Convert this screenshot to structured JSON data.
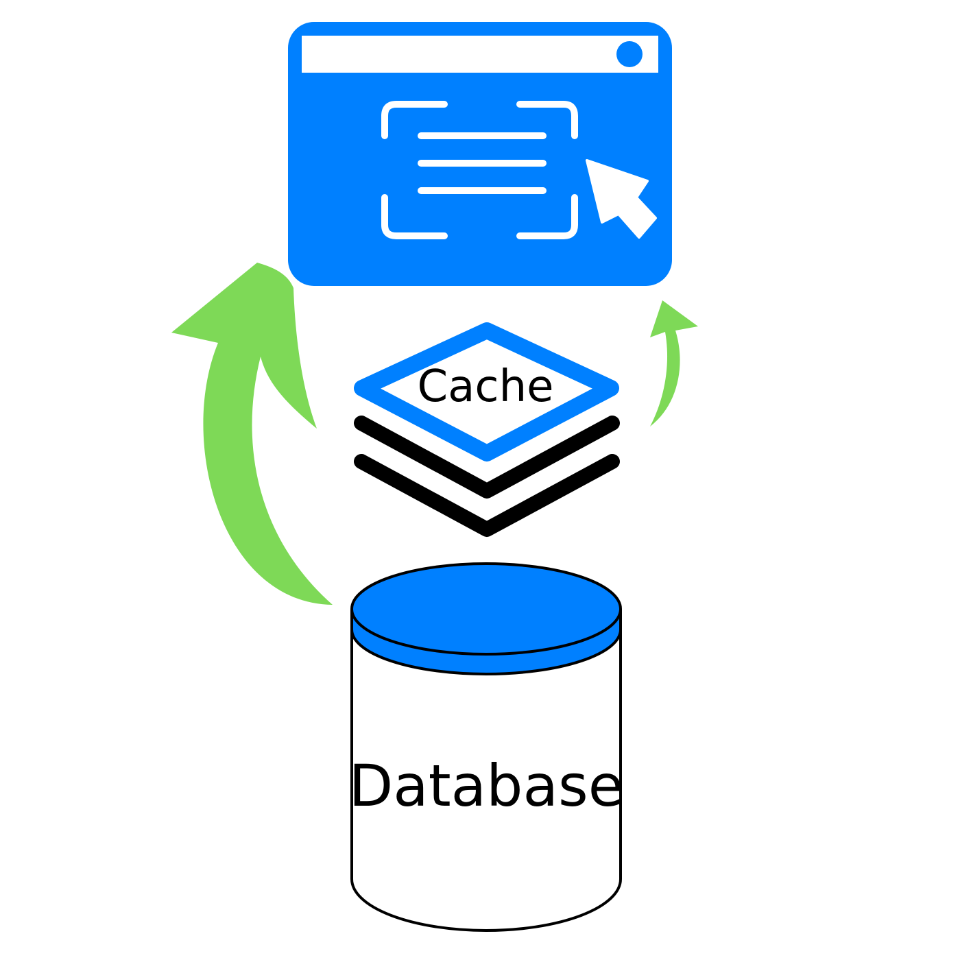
{
  "diagram": {
    "cache_label": "Cache",
    "database_label": "Database"
  },
  "icons": {
    "browser": "browser-window-icon",
    "screenshot": "screen-capture-icon",
    "cursor": "cursor-pointer-icon",
    "cache": "layered-cache-icon",
    "database": "database-cylinder-icon"
  },
  "colors": {
    "blue": "#0080ff",
    "green": "#7ed957",
    "black": "#000000",
    "white": "#ffffff"
  }
}
